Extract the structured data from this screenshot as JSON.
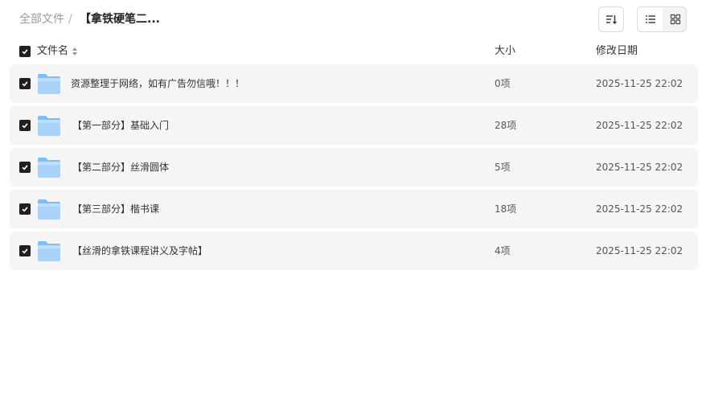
{
  "breadcrumb": {
    "root": "全部文件",
    "separator": "/",
    "current": "【拿铁硬笔二..."
  },
  "toolbar": {
    "sort_icon": "sort-icon",
    "list_view_icon": "list-view-icon",
    "grid_view_icon": "grid-view-icon",
    "active_view": "list"
  },
  "table": {
    "columns": {
      "name": "文件名",
      "size": "大小",
      "modified": "修改日期"
    },
    "all_selected": true,
    "rows": [
      {
        "name": "资源整理于网络，如有广告勿信哦！！！",
        "size": "0项",
        "modified": "2025-11-25 22:02",
        "selected": true
      },
      {
        "name": "【第一部分】基础入门",
        "size": "28项",
        "modified": "2025-11-25 22:02",
        "selected": true
      },
      {
        "name": "【第二部分】丝滑圆体",
        "size": "5项",
        "modified": "2025-11-25 22:02",
        "selected": true
      },
      {
        "name": "【第三部分】楷书课",
        "size": "18项",
        "modified": "2025-11-25 22:02",
        "selected": true
      },
      {
        "name": "【丝滑的拿铁课程讲义及字帖】",
        "size": "4项",
        "modified": "2025-11-25 22:02",
        "selected": true
      }
    ]
  },
  "colors": {
    "row_bg": "#f5f5f5",
    "checkbox": "#1f1f1f",
    "folder_light": "#a9d3fb",
    "folder_dark": "#6fb2f3"
  }
}
